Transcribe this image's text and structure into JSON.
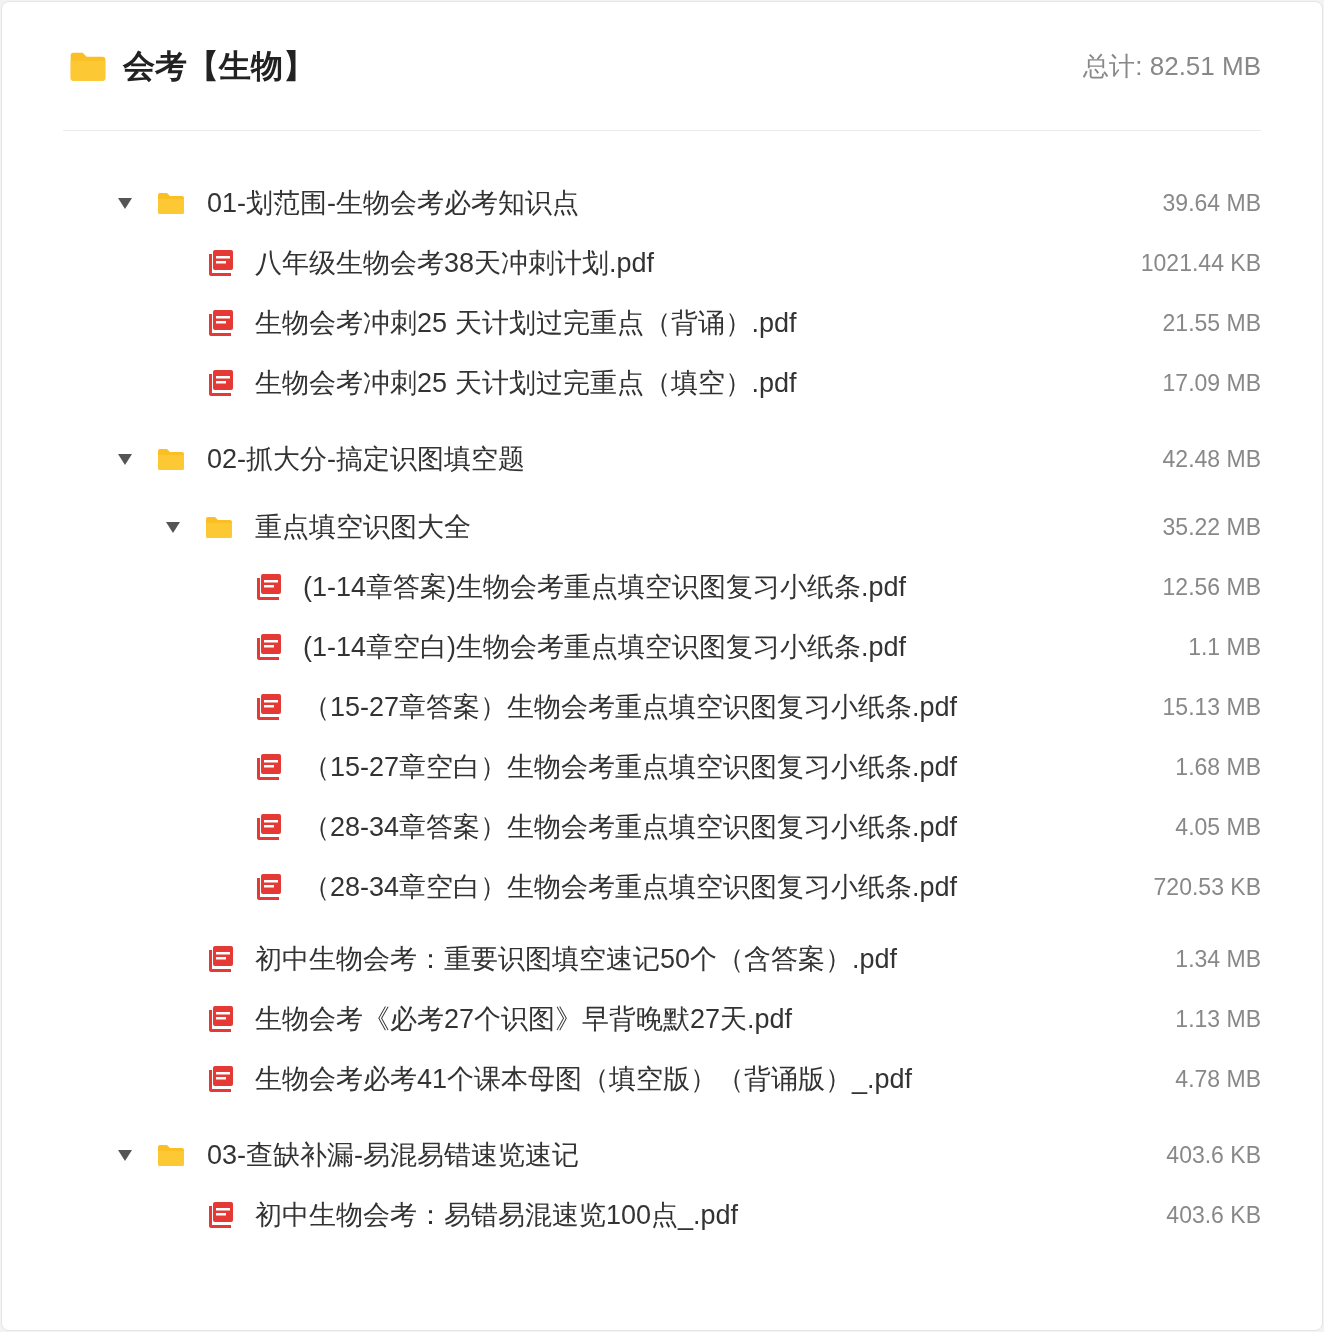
{
  "header": {
    "title": "会考【生物】",
    "total": "总计: 82.51 MB"
  },
  "tree": [
    {
      "kind": "folder",
      "name": "01-划范围-生物会考必考知识点",
      "size": "39.64 MB",
      "expanded": true,
      "children": [
        {
          "kind": "pdf",
          "name": "八年级生物会考38天冲刺计划.pdf",
          "size": "1021.44 KB"
        },
        {
          "kind": "pdf",
          "name": "生物会考冲刺25 天计划过完重点（背诵）.pdf",
          "size": "21.55 MB"
        },
        {
          "kind": "pdf",
          "name": "生物会考冲刺25 天计划过完重点（填空）.pdf",
          "size": "17.09 MB"
        }
      ]
    },
    {
      "kind": "folder",
      "name": "02-抓大分-搞定识图填空题",
      "size": "42.48 MB",
      "expanded": true,
      "children": [
        {
          "kind": "folder",
          "name": "重点填空识图大全",
          "size": "35.22 MB",
          "expanded": true,
          "children": [
            {
              "kind": "pdf",
              "name": "(1-14章答案)生物会考重点填空识图复习小纸条.pdf",
              "size": "12.56 MB"
            },
            {
              "kind": "pdf",
              "name": "(1-14章空白)生物会考重点填空识图复习小纸条.pdf",
              "size": "1.1 MB"
            },
            {
              "kind": "pdf",
              "name": "（15-27章答案）生物会考重点填空识图复习小纸条.pdf",
              "size": "15.13 MB"
            },
            {
              "kind": "pdf",
              "name": "（15-27章空白）生物会考重点填空识图复习小纸条.pdf",
              "size": "1.68 MB"
            },
            {
              "kind": "pdf",
              "name": "（28-34章答案）生物会考重点填空识图复习小纸条.pdf",
              "size": "4.05 MB"
            },
            {
              "kind": "pdf",
              "name": "（28-34章空白）生物会考重点填空识图复习小纸条.pdf",
              "size": "720.53 KB"
            }
          ]
        },
        {
          "kind": "pdf",
          "name": "初中生物会考：重要识图填空速记50个（含答案）.pdf",
          "size": "1.34 MB"
        },
        {
          "kind": "pdf",
          "name": "生物会考《必考27个识图》早背晚默27天.pdf",
          "size": "1.13 MB"
        },
        {
          "kind": "pdf",
          "name": "生物会考必考41个课本母图（填空版）（背诵版）_.pdf",
          "size": "4.78 MB"
        }
      ]
    },
    {
      "kind": "folder",
      "name": "03-查缺补漏-易混易错速览速记",
      "size": "403.6 KB",
      "expanded": true,
      "children": [
        {
          "kind": "pdf",
          "name": "初中生物会考：易错易混速览100点_.pdf",
          "size": "403.6 KB"
        }
      ]
    }
  ]
}
